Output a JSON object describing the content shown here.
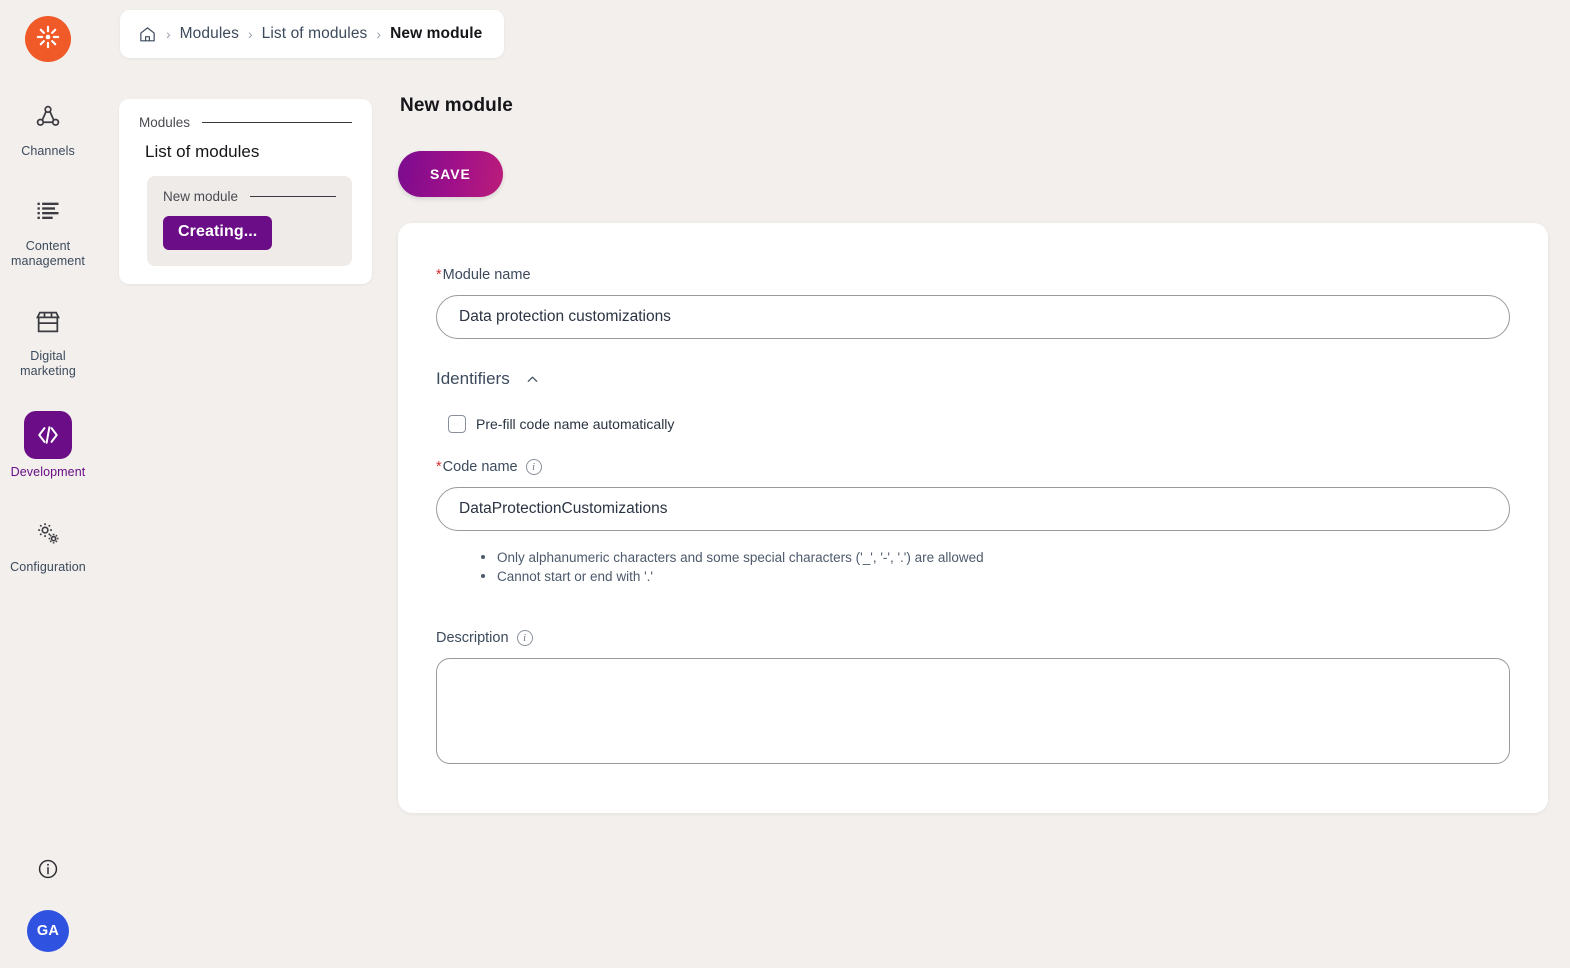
{
  "app": {
    "logo_icon": "kentico-asterisk-logo"
  },
  "breadcrumb": {
    "home_icon": "home-icon",
    "separator": "›",
    "items": [
      {
        "label": "Modules",
        "current": false
      },
      {
        "label": "List of modules",
        "current": false
      },
      {
        "label": "New module",
        "current": true
      }
    ]
  },
  "sidebar": {
    "items": [
      {
        "label": "Channels",
        "icon": "channels-network-icon",
        "active": false
      },
      {
        "label": "Content management",
        "icon": "content-lines-icon",
        "active": false
      },
      {
        "label": "Digital marketing",
        "icon": "storefront-icon",
        "active": false
      },
      {
        "label": "Development",
        "icon": "code-brackets-icon",
        "active": true
      },
      {
        "label": "Configuration",
        "icon": "gears-icon",
        "active": false
      }
    ],
    "bottom": {
      "info_icon": "info-circle-icon",
      "avatar_initials": "GA"
    }
  },
  "subnav": {
    "section_label": "Modules",
    "title": "List of modules",
    "panel": {
      "label": "New module",
      "status_button": "Creating..."
    }
  },
  "main": {
    "page_title": "New module",
    "save_label": "SAVE",
    "form": {
      "module_name": {
        "label": "Module name",
        "required_marker": "*",
        "value": "Data protection customizations",
        "placeholder": ""
      },
      "identifiers_section": {
        "label": "Identifiers",
        "chevron_icon": "chevron-up-icon",
        "expanded": true
      },
      "prefill_checkbox": {
        "label": "Pre-fill code name automatically",
        "checked": false
      },
      "code_name": {
        "label": "Code name",
        "required_marker": "*",
        "info_icon": "info-icon",
        "value": "DataProtectionCustomizations",
        "placeholder": "",
        "hints": [
          "Only alphanumeric characters and some special characters ('_', '-', '.') are allowed",
          "Cannot start or end with '.'"
        ]
      },
      "description": {
        "label": "Description",
        "info_icon": "info-icon",
        "value": "",
        "placeholder": ""
      }
    }
  },
  "colors": {
    "brand_orange": "#f05a28",
    "accent_purple": "#6a0d86",
    "save_gradient_start": "#7b0b8f",
    "save_gradient_end": "#bb1d7a",
    "avatar_blue": "#2f52e0",
    "required_red": "#d63333",
    "page_background": "#f2efec"
  }
}
